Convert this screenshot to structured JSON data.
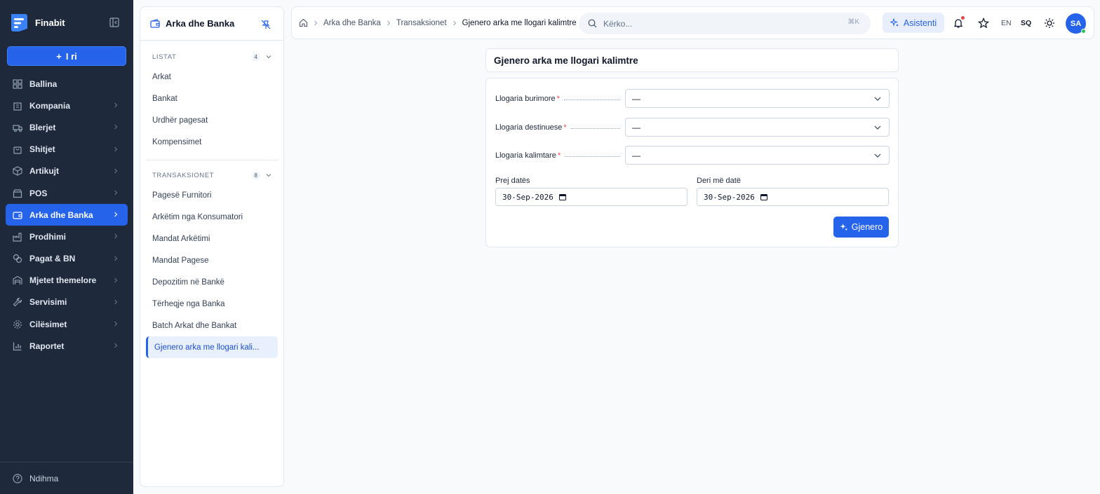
{
  "app": {
    "name": "Finabit",
    "new_label": "I ri",
    "help_label": "Ndihma"
  },
  "nav": [
    {
      "label": "Ballina",
      "icon": "dashboard-icon",
      "has_chevron": false
    },
    {
      "label": "Kompania",
      "icon": "building-icon",
      "has_chevron": true
    },
    {
      "label": "Blerjet",
      "icon": "truck-icon",
      "has_chevron": true
    },
    {
      "label": "Shitjet",
      "icon": "shopping-bag-icon",
      "has_chevron": true
    },
    {
      "label": "Artikujt",
      "icon": "box-icon",
      "has_chevron": true
    },
    {
      "label": "POS",
      "icon": "store-icon",
      "has_chevron": true
    },
    {
      "label": "Arka dhe Banka",
      "icon": "wallet-icon",
      "has_chevron": true,
      "active": true
    },
    {
      "label": "Prodhimi",
      "icon": "factory-icon",
      "has_chevron": true
    },
    {
      "label": "Pagat & BN",
      "icon": "coins-icon",
      "has_chevron": true
    },
    {
      "label": "Mjetet themelore",
      "icon": "warehouse-icon",
      "has_chevron": true
    },
    {
      "label": "Servisimi",
      "icon": "wrench-icon",
      "has_chevron": true
    },
    {
      "label": "Cilësimet",
      "icon": "gear-icon",
      "has_chevron": true
    },
    {
      "label": "Raportet",
      "icon": "bar-chart-icon",
      "has_chevron": true
    }
  ],
  "panel": {
    "title": "Arka dhe Banka",
    "groups": [
      {
        "label": "LISTAT",
        "count": "4",
        "items": [
          "Arkat",
          "Bankat",
          "Urdhër pagesat",
          "Kompensimet"
        ]
      },
      {
        "label": "TRANSAKSIONET",
        "count": "8",
        "items": [
          "Pagesë Furnitori",
          "Arkëtim nga Konsumatori",
          "Mandat Arkëtimi",
          "Mandat Pagese",
          "Depozitim në Bankë",
          "Tërheqje nga Banka",
          "Batch Arkat dhe Bankat",
          "Gjenero arka me llogari kali..."
        ]
      }
    ],
    "active_item": "Gjenero arka me llogari kali..."
  },
  "topbar": {
    "breadcrumbs": [
      "Arka dhe Banka",
      "Transaksionet",
      "Gjenero arka me llogari kalimtre"
    ],
    "search_placeholder": "Kërko...",
    "search_shortcut": "⌘K",
    "assistant_label": "Asistenti",
    "lang_en": "EN",
    "lang_sq": "SQ",
    "avatar_initials": "SA"
  },
  "form": {
    "title": "Gjenero arka me llogari kalimtre",
    "fields": [
      {
        "label": "Llogaria burimore",
        "required": true,
        "value": "—"
      },
      {
        "label": "Llogaria destinuese",
        "required": true,
        "value": "—"
      },
      {
        "label": "Llogaria kalimtare",
        "required": true,
        "value": "—"
      }
    ],
    "date_from_label": "Prej datës",
    "date_from_value": "30-Sep-2026",
    "date_to_label": "Deri më datë",
    "date_to_value": "30-Sep-2026",
    "submit_label": "Gjenero"
  },
  "colors": {
    "accent": "#2563eb",
    "sidebar_bg": "#1e293b",
    "required": "#ef4444"
  }
}
